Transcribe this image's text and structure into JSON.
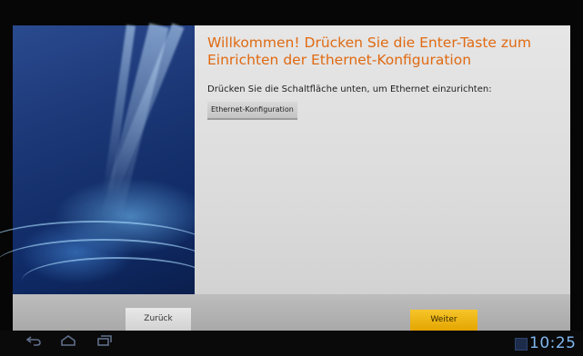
{
  "welcome": {
    "title": "Willkommen! Drücken Sie die Enter-Taste zum Einrichten der Ethernet-Konfiguration",
    "subtitle": "Drücken Sie die Schaltfläche unten, um Ethernet einzurichten:",
    "ethernet_button_label": "Ethernet-Konfiguration"
  },
  "footer": {
    "back_label": "Zurück",
    "next_label": "Weiter"
  },
  "system_bar": {
    "nav_icons": [
      "back-icon",
      "home-icon",
      "recent-apps-icon"
    ],
    "status_icon": "notification-icon",
    "clock": "10:25"
  },
  "colors": {
    "title_orange": "#e06a12",
    "next_button_yellow": "#f2bb1e",
    "clock_blue": "#7fb7f0",
    "content_gray": "#e0e0e0"
  }
}
